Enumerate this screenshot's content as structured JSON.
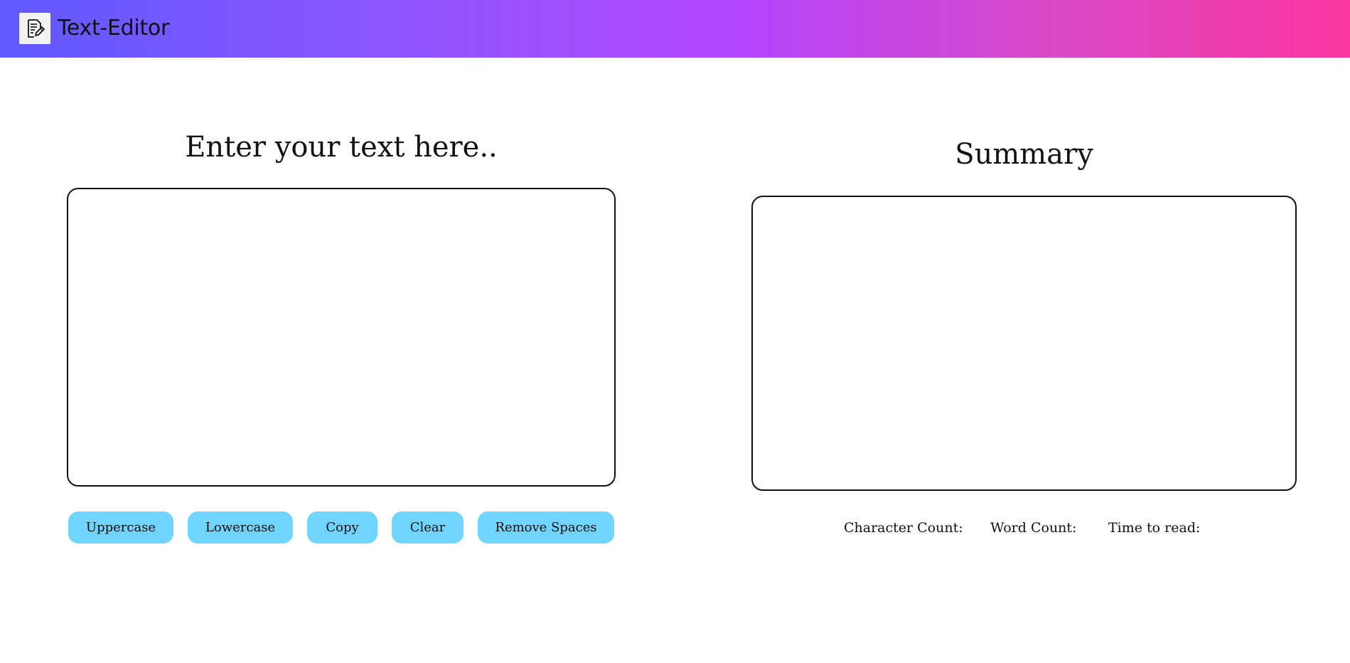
{
  "navbar": {
    "logo_icon": "edit-note-icon",
    "title": "Text-Editor",
    "gradient_colors": [
      "#6059ff",
      "#b344fb",
      "#fb359f"
    ]
  },
  "editor": {
    "heading": "Enter your text here..",
    "input_value": "",
    "buttons": {
      "uppercase": "Uppercase",
      "lowercase": "Lowercase",
      "copy": "Copy",
      "clear": "Clear",
      "remove_spaces": "Remove Spaces"
    },
    "button_color": "#6fd4fe"
  },
  "summary": {
    "heading": "Summary",
    "output_value": "",
    "stats": {
      "character_count_label": "Character Count:",
      "word_count_label": "Word Count:",
      "time_to_read_label": "Time to read:"
    }
  }
}
